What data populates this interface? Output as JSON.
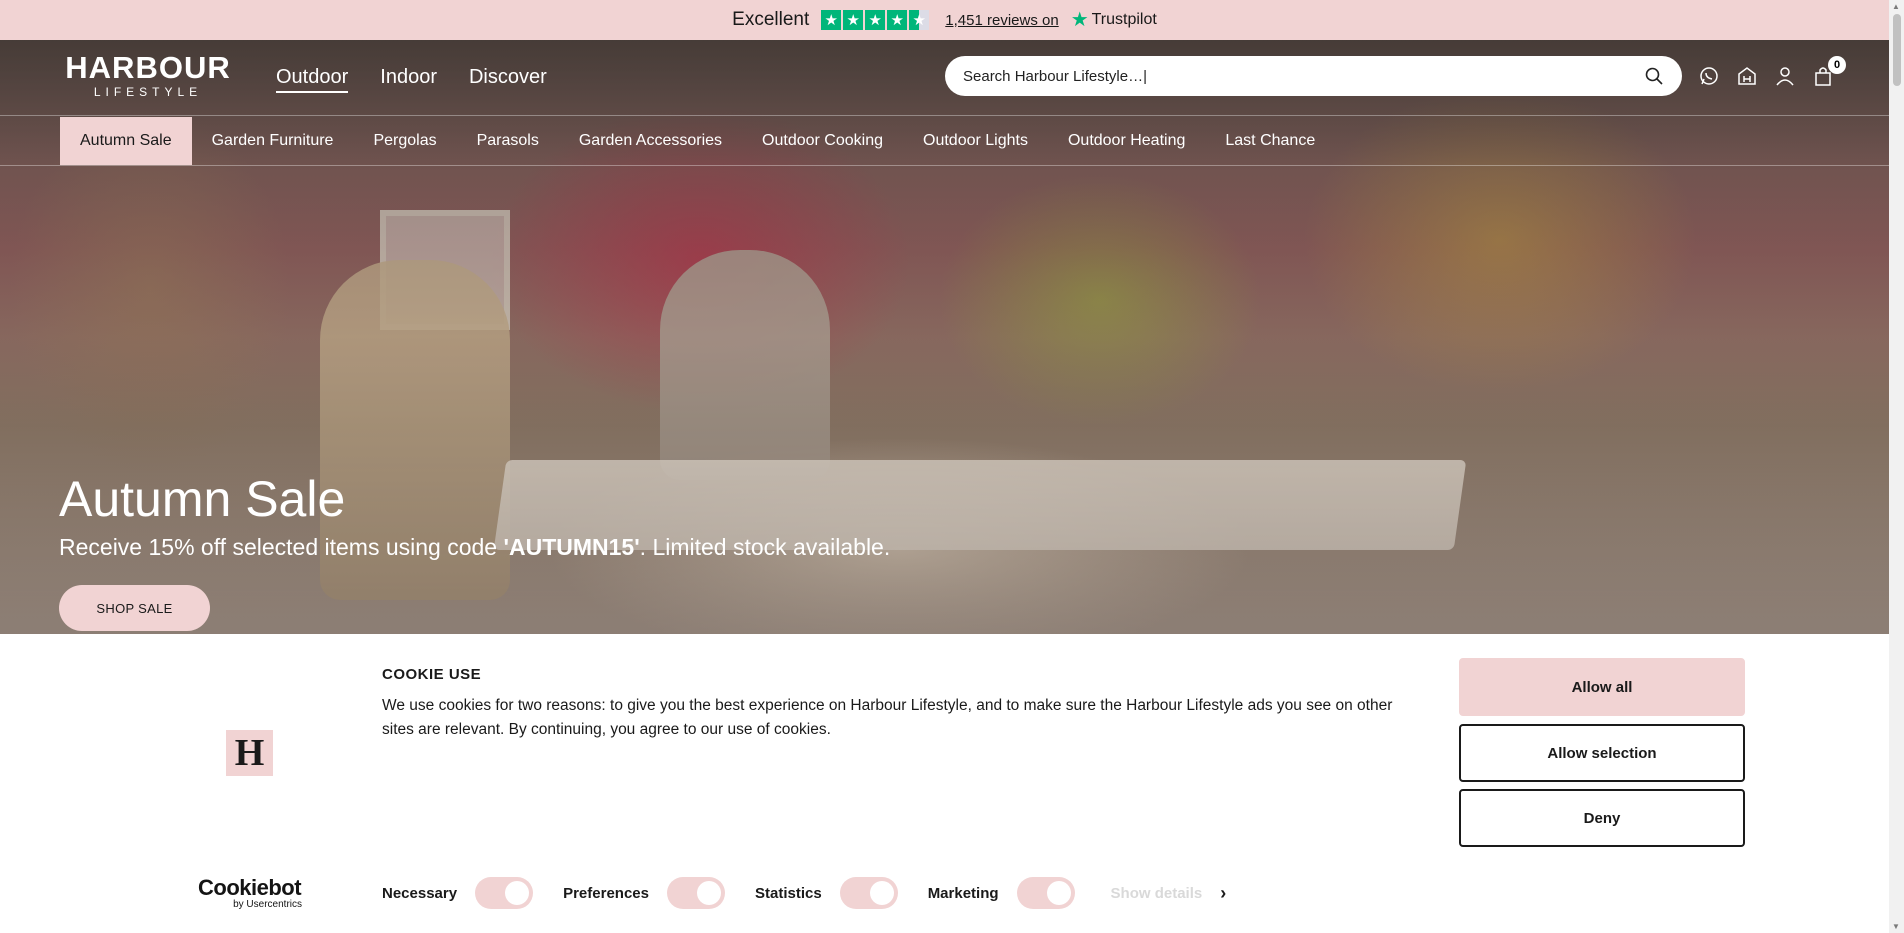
{
  "colors": {
    "brand_pink": "#f1d3d3",
    "trustpilot_green": "#00b67a",
    "text_dark": "#1a1a1a"
  },
  "trustpilot": {
    "rating_text": "Excellent",
    "stars": 4.5,
    "reviews_link": "1,451 reviews on",
    "brand": "Trustpilot",
    "star_glyph": "★"
  },
  "header": {
    "logo_main": "HARBOUR",
    "logo_sub": "LIFESTYLE",
    "main_nav": [
      {
        "label": "Outdoor",
        "active": true
      },
      {
        "label": "Indoor",
        "active": false
      },
      {
        "label": "Discover",
        "active": false
      }
    ],
    "search_value": "Search Harbour Lifestyle…|",
    "icons": [
      "whatsapp-icon",
      "store-icon",
      "account-icon",
      "bag-icon"
    ],
    "cart_count": "0"
  },
  "sub_nav": [
    {
      "label": "Autumn Sale",
      "active": true
    },
    {
      "label": "Garden Furniture",
      "active": false
    },
    {
      "label": "Pergolas",
      "active": false
    },
    {
      "label": "Parasols",
      "active": false
    },
    {
      "label": "Garden Accessories",
      "active": false
    },
    {
      "label": "Outdoor Cooking",
      "active": false
    },
    {
      "label": "Outdoor Lights",
      "active": false
    },
    {
      "label": "Outdoor Heating",
      "active": false
    },
    {
      "label": "Last Chance",
      "active": false
    }
  ],
  "hero": {
    "title": "Autumn Sale",
    "text_before": "Receive 15% off selected items using code ",
    "code": "'AUTUMN15'",
    "text_after": ". Limited stock available.",
    "button_label": "SHOP SALE"
  },
  "cookie": {
    "logo_letter": "H",
    "title": "COOKIE USE",
    "text": "We use cookies for two reasons: to give you the best experience on Harbour Lifestyle, and to make sure the Harbour Lifestyle ads you see on other sites are relevant. By continuing, you agree to our use of cookies.",
    "allow_all": "Allow all",
    "allow_selection": "Allow selection",
    "deny": "Deny",
    "provider_main": "Cookiebot",
    "provider_sub": "by Usercentrics",
    "toggles": [
      {
        "label": "Necessary",
        "on": true
      },
      {
        "label": "Preferences",
        "on": true
      },
      {
        "label": "Statistics",
        "on": true
      },
      {
        "label": "Marketing",
        "on": true
      }
    ],
    "show_details": "Show details",
    "chevron": "›"
  }
}
